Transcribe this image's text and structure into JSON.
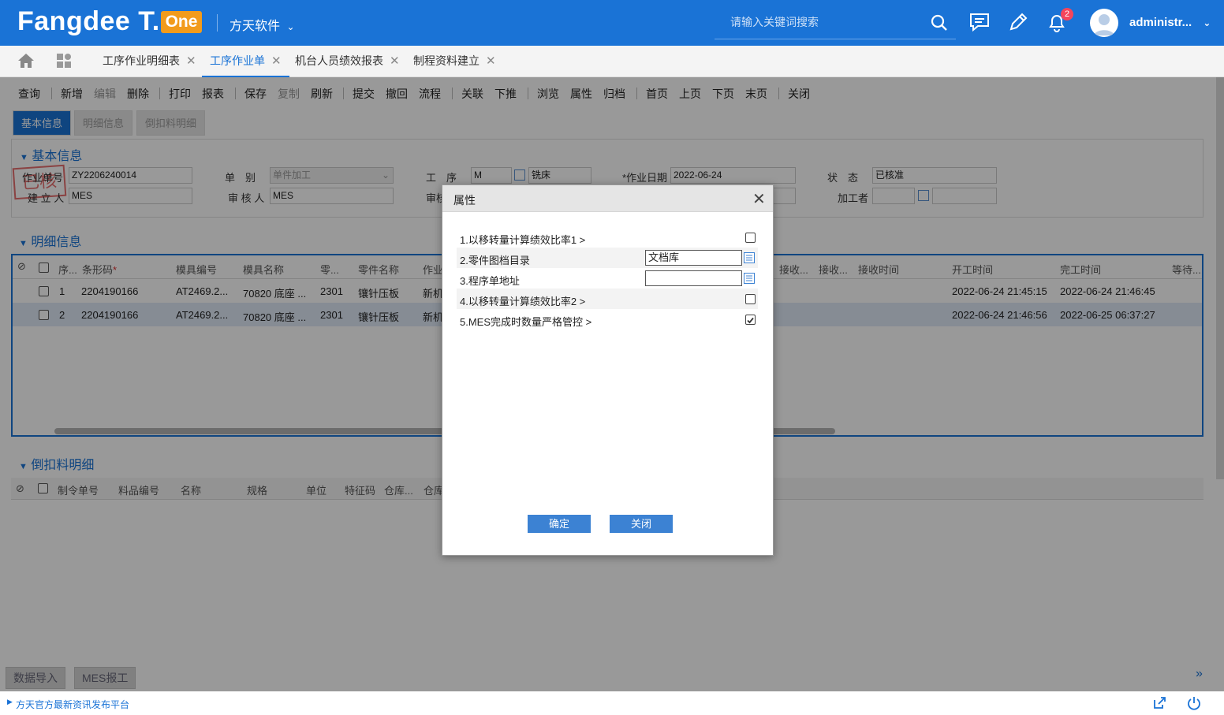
{
  "header": {
    "logo_text": "Fangdee T.",
    "logo_badge": "One",
    "company": "方天软件",
    "search_placeholder": "请输入关键词搜索",
    "notification_count": "2",
    "username": "administr..."
  },
  "tabs": [
    {
      "label": "工序作业明细表",
      "active": false
    },
    {
      "label": "工序作业单",
      "active": true
    },
    {
      "label": "机台人员绩效报表",
      "active": false
    },
    {
      "label": "制程资料建立",
      "active": false
    }
  ],
  "toolbar": {
    "query": "查询",
    "new": "新增",
    "edit": "编辑",
    "delete": "删除",
    "print": "打印",
    "report": "报表",
    "save": "保存",
    "copy": "复制",
    "refresh": "刷新",
    "submit": "提交",
    "withdraw": "撤回",
    "flow": "流程",
    "link": "关联",
    "push_down": "下推",
    "browse": "浏览",
    "property": "属性",
    "archive": "归档",
    "first": "首页",
    "prev": "上页",
    "next": "下页",
    "last": "末页",
    "close": "关闭"
  },
  "subtabs": [
    "基本信息",
    "明细信息",
    "倒扣料明细"
  ],
  "basic_info": {
    "title": "基本信息",
    "stamp": "已核",
    "labels": {
      "doc_no": "作业单号",
      "doc_type": "单　别",
      "process": "工　序",
      "work_date": "*作业日期",
      "status": "状　态",
      "creator": "建 立 人",
      "reviewer": "审 核 人",
      "reviewer2": "审核",
      "worker": "加工者"
    },
    "values": {
      "doc_no": "ZY2206240014",
      "doc_type": "单件加工",
      "process_code": "M",
      "process_name": "铣床",
      "work_date": "2022-06-24",
      "status": "已核准",
      "creator": "MES",
      "reviewer": "MES",
      "worker": ""
    }
  },
  "detail": {
    "title": "明细信息",
    "columns": [
      "序...",
      "条形码",
      "模具编号",
      "模具名称",
      "零...",
      "零件名称",
      "作业",
      "接收...",
      "接收...",
      "接收时间",
      "开工时间",
      "完工时间",
      "等待..."
    ],
    "rows": [
      {
        "seq": "1",
        "barcode": "2204190166",
        "mold_no": "AT2469.2...",
        "mold_name": "70820 底座 ...",
        "part": "2301",
        "part_name": "镶针压板",
        "op": "新机",
        "start": "2022-06-24 21:45:15",
        "end": "2022-06-24 21:46:45"
      },
      {
        "seq": "2",
        "barcode": "2204190166",
        "mold_no": "AT2469.2...",
        "mold_name": "70820 底座 ...",
        "part": "2301",
        "part_name": "镶针压板",
        "op": "新机",
        "start": "2022-06-24 21:46:56",
        "end": "2022-06-25 06:37:27"
      }
    ]
  },
  "backflush": {
    "title": "倒扣料明细",
    "columns": [
      "制令单号",
      "料品编号",
      "名称",
      "规格",
      "单位",
      "特征码",
      "仓库...",
      "仓库"
    ]
  },
  "modal": {
    "title": "属性",
    "rows": [
      {
        "label": "1.以移转量计算绩效比率1 >",
        "kind": "checkbox",
        "checked": false
      },
      {
        "label": "2.零件图档目录",
        "kind": "input",
        "value": "文档库"
      },
      {
        "label": "3.程序单地址",
        "kind": "input",
        "value": ""
      },
      {
        "label": "4.以移转量计算绩效比率2 >",
        "kind": "checkbox",
        "checked": false
      },
      {
        "label": "5.MES完成时数量严格管控 >",
        "kind": "checkbox",
        "checked": true
      }
    ],
    "ok": "确定",
    "close": "关闭"
  },
  "bottom_tabs": [
    "数据导入",
    "MES报工"
  ],
  "footer": {
    "news": "方天官方最新资讯发布平台"
  },
  "colors": {
    "brand": "#1a73d6",
    "logo_badge": "#f29b1b",
    "badge": "#f5455b",
    "button": "#3c82d3"
  }
}
